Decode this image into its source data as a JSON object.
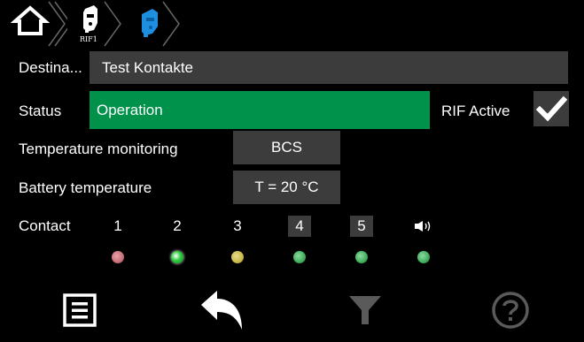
{
  "breadcrumb": {
    "home_icon": "home-icon",
    "items": [
      {
        "icon": "device-white-icon",
        "label": "RIF1"
      },
      {
        "icon": "device-blue-icon",
        "label": ""
      }
    ]
  },
  "rows": {
    "destination": {
      "label": "Destina...",
      "value": "Test Kontakte"
    },
    "status": {
      "label": "Status",
      "value": "Operation",
      "color": "#00924a"
    },
    "rif_active": {
      "label": "RIF Active",
      "checked": true
    },
    "temperature_monitoring": {
      "label": "Temperature monitoring",
      "value": "BCS"
    },
    "battery_temperature": {
      "label": "Battery temperature",
      "value": "T = 20 °C"
    }
  },
  "contact": {
    "label": "Contact",
    "items": [
      {
        "number": "1",
        "boxed": false,
        "led_color": "#c8707a"
      },
      {
        "number": "2",
        "boxed": false,
        "led_color": "#2ecc40"
      },
      {
        "number": "3",
        "boxed": false,
        "led_color": "#c9b84a"
      },
      {
        "number": "4",
        "boxed": true,
        "led_color": "#3fae5c"
      },
      {
        "number": "5",
        "boxed": true,
        "led_color": "#3fae5c"
      }
    ],
    "speaker": {
      "icon": "speaker-icon",
      "led_color": "#3fae5c"
    }
  },
  "bottom_bar": {
    "buttons": [
      {
        "icon": "menu-icon",
        "enabled": true
      },
      {
        "icon": "back-icon",
        "enabled": true
      },
      {
        "icon": "filter-icon",
        "enabled": false
      },
      {
        "icon": "help-icon",
        "enabled": false
      }
    ]
  },
  "colors": {
    "background": "#000000",
    "field": "#3c3c3c",
    "status_green": "#00924a",
    "disabled_icon": "#5a5a5a"
  }
}
